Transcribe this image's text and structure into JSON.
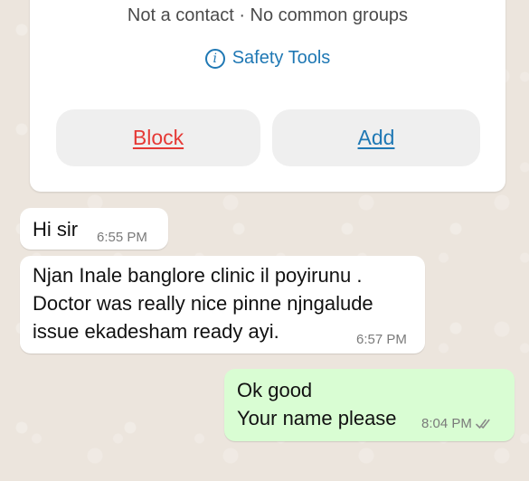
{
  "info_card": {
    "contact_status": "Not a contact · No common groups",
    "safety_tools_label": "Safety Tools",
    "safety_icon": "info-icon",
    "block_label": "Block",
    "add_label": "Add",
    "colors": {
      "block": "#e53935",
      "add": "#1f78b4"
    }
  },
  "messages": [
    {
      "direction": "incoming",
      "text": "Hi sir",
      "time": "6:55 PM"
    },
    {
      "direction": "incoming",
      "text": "Njan Inale banglore clinic il poyirunu .\nDoctor was really nice pinne njngalude\nissue ekadesham ready ayi.",
      "time": "6:57 PM"
    },
    {
      "direction": "outgoing",
      "text": "Ok good\nYour name please",
      "time": "8:04 PM",
      "status_icon": "double-check-icon"
    }
  ]
}
